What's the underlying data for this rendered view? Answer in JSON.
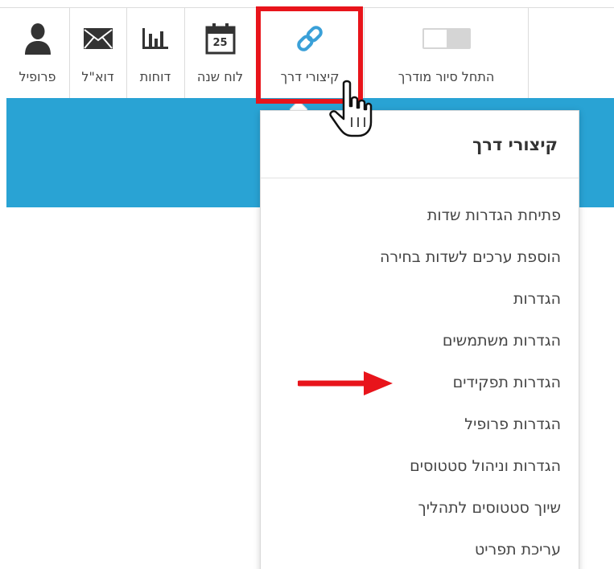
{
  "toolbar": {
    "profile_label": "פרופיל",
    "email_label": "דוא\"ל",
    "reports_label": "דוחות",
    "calendar_label": "לוח שנה",
    "calendar_day": "25",
    "shortcuts_label": "קיצורי דרך",
    "tour_label": "התחל סיור מודרך"
  },
  "dropdown": {
    "title": "קיצורי דרך",
    "items": [
      "פתיחת הגדרות שדות",
      "הוספת ערכים לשדות בחירה",
      "הגדרות",
      "הגדרות משתמשים",
      "הגדרות תפקידים",
      "הגדרות פרופיל",
      "הגדרות וניהול סטטוסים",
      "שיוך סטטוסים לתהליך",
      "עריכת תפריט"
    ]
  },
  "colors": {
    "accent_blue": "#29a3d4",
    "highlight_red": "#e8141b",
    "shortcut_icon": "#3aa0d8",
    "icon_dark": "#333333"
  },
  "icons": {
    "profile": "person-icon",
    "email": "envelope-icon",
    "reports": "bar-chart-icon",
    "calendar": "calendar-icon",
    "shortcuts": "link-icon",
    "tour": "toggle-switch-icon",
    "annotation": "red-arrow-icon",
    "pointer": "hand-cursor-icon"
  }
}
